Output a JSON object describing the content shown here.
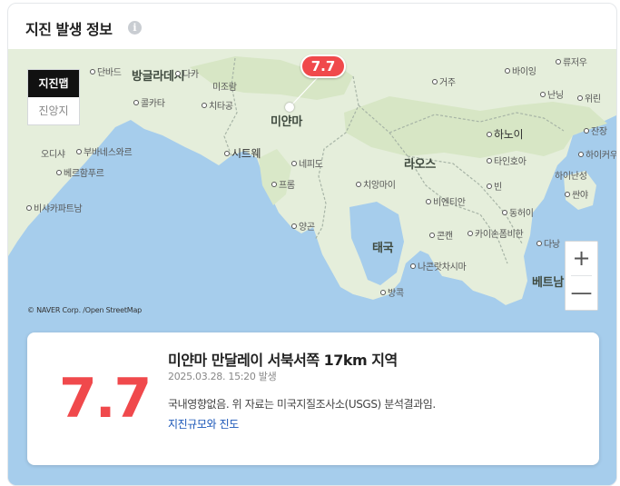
{
  "header": {
    "title": "지진 발생 정보",
    "info_icon": "info-icon"
  },
  "map": {
    "tabs": [
      {
        "label": "지진맵",
        "active": true
      },
      {
        "label": "진앙지",
        "active": false
      }
    ],
    "labels": [
      {
        "text": "단바드",
        "kind": "city"
      },
      {
        "text": "방글라데시",
        "kind": "country"
      },
      {
        "text": "다카",
        "kind": "city"
      },
      {
        "text": "미조람",
        "kind": "plain"
      },
      {
        "text": "콜카타",
        "kind": "city"
      },
      {
        "text": "치타공",
        "kind": "city"
      },
      {
        "text": "미얀마",
        "kind": "country"
      },
      {
        "text": "부바네스와르",
        "kind": "city"
      },
      {
        "text": "시트웨",
        "kind": "city"
      },
      {
        "text": "오디샤",
        "kind": "plain"
      },
      {
        "text": "베르함푸르",
        "kind": "city"
      },
      {
        "text": "비샤카파트남",
        "kind": "city"
      },
      {
        "text": "네피도",
        "kind": "city"
      },
      {
        "text": "프롬",
        "kind": "city"
      },
      {
        "text": "양곤",
        "kind": "city"
      },
      {
        "text": "치앙마이",
        "kind": "city"
      },
      {
        "text": "라오스",
        "kind": "country"
      },
      {
        "text": "비엔티안",
        "kind": "city"
      },
      {
        "text": "태국",
        "kind": "country"
      },
      {
        "text": "콘캔",
        "kind": "city"
      },
      {
        "text": "나콘랏차시마",
        "kind": "city"
      },
      {
        "text": "방콕",
        "kind": "city"
      },
      {
        "text": "카이손폼비한",
        "kind": "city"
      },
      {
        "text": "하노이",
        "kind": "city"
      },
      {
        "text": "타인호아",
        "kind": "city"
      },
      {
        "text": "빈",
        "kind": "city"
      },
      {
        "text": "동허이",
        "kind": "city"
      },
      {
        "text": "다낭",
        "kind": "city"
      },
      {
        "text": "베트남",
        "kind": "country"
      },
      {
        "text": "바이잉",
        "kind": "city"
      },
      {
        "text": "류저우",
        "kind": "city"
      },
      {
        "text": "거주",
        "kind": "city"
      },
      {
        "text": "난닝",
        "kind": "city"
      },
      {
        "text": "위린",
        "kind": "city"
      },
      {
        "text": "잔장",
        "kind": "city"
      },
      {
        "text": "하이커우",
        "kind": "city"
      },
      {
        "text": "하이난성",
        "kind": "plain"
      },
      {
        "text": "싼야",
        "kind": "city"
      }
    ],
    "zoom_in": "+",
    "zoom_out": "—",
    "copyright": "© NAVER Corp. /Open StreetMap",
    "marker_magnitude": "7.7"
  },
  "detail": {
    "magnitude": "7.7",
    "location": "미얀마 만달레이 서북서쪽 17km 지역",
    "time": "2025.03.28. 15:20 발생",
    "description": "국내영향없음. 위 자료는 미국지질조사소(USGS) 분석결과임.",
    "link": "지진규모와 진도"
  },
  "colors": {
    "accent": "#f0494c",
    "water": "#a6cdec",
    "land": "#e5eedb",
    "link": "#1a56b8"
  }
}
